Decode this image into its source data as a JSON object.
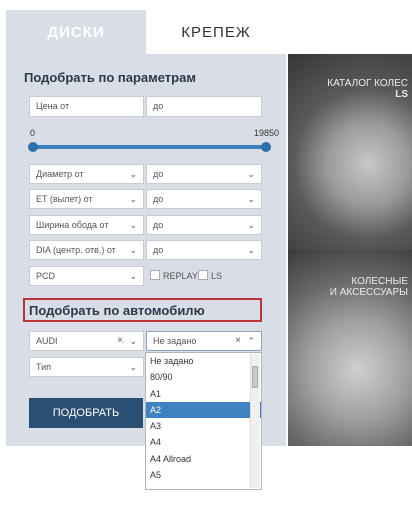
{
  "tabs": [
    {
      "label": "ДИСКИ"
    },
    {
      "label": "КРЕПЕЖ"
    }
  ],
  "params": {
    "title": "Подобрать по параметрам",
    "price_from": "Цена от",
    "price_to": "до",
    "slider_min": "0",
    "slider_max": "19850",
    "diameter_from": "Диаметр от",
    "diameter_to": "до",
    "et_from": "ET (вылет) от",
    "et_to": "до",
    "width_from": "Ширина обода от",
    "width_to": "до",
    "dia_from": "DIA (центр. отв.) от",
    "dia_to": "до",
    "pcd": "PCD",
    "replay": "REPLAY",
    "ls": "LS"
  },
  "car": {
    "title": "Подобрать по автомобилю",
    "make": "AUDI",
    "model": "Не задано",
    "type": "Тип",
    "submit": "ПОДОБРАТЬ"
  },
  "dropdown": {
    "options": [
      "Не задано",
      "80/90",
      "A1",
      "A2",
      "A3",
      "A4",
      "A4 Allroad",
      "A5"
    ],
    "selected_index": 3
  },
  "promo": {
    "top_line1": "КАТАЛОГ КОЛЕС",
    "top_line2": "LS",
    "bottom_line1": "КОЛЕСНЫЕ",
    "bottom_line2": "И АКСЕССУАРЫ"
  },
  "colors": {
    "panel_bg": "#d8dde6",
    "accent_blue": "#3e82c2",
    "button_bg": "#2b4f73",
    "highlight_border": "#b8333a"
  },
  "icons": [
    "chevron-down-icon",
    "clear-x-icon",
    "chevron-up-icon"
  ]
}
